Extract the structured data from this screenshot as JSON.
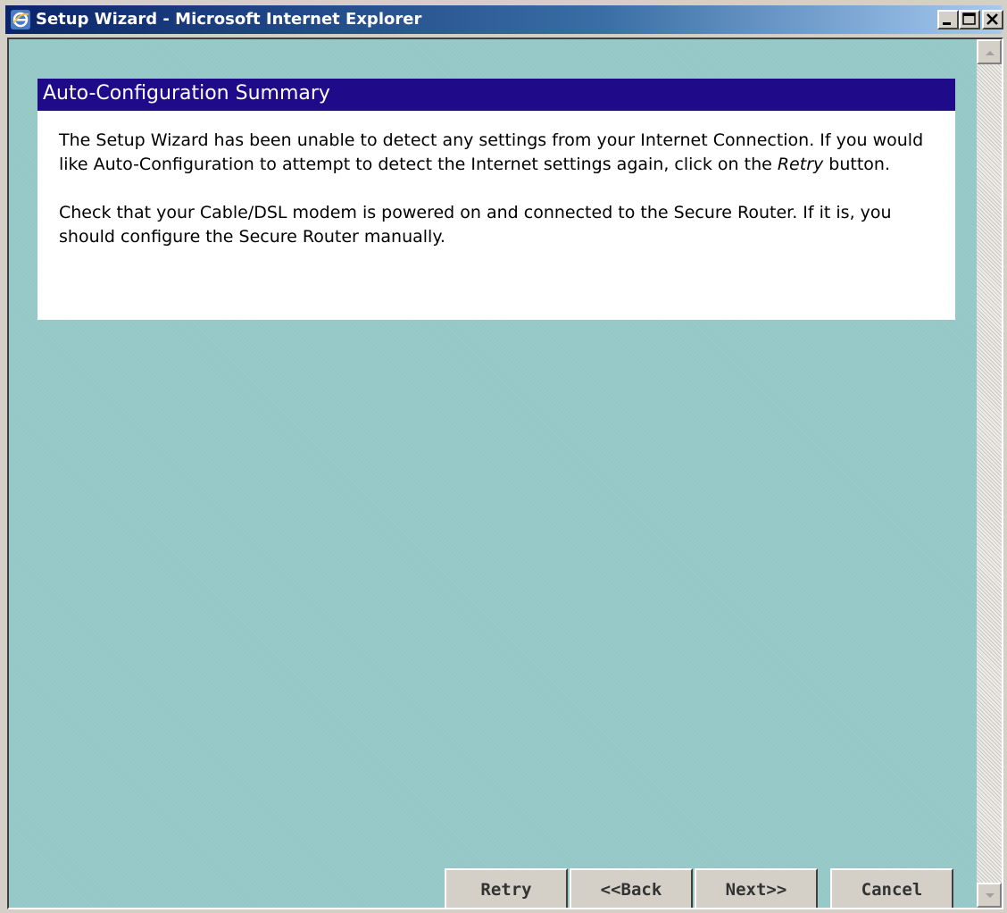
{
  "window": {
    "title": "Setup Wizard - Microsoft Internet Explorer",
    "icon": "internet-explorer-icon"
  },
  "panel": {
    "title": "Auto-Configuration Summary",
    "paragraph1_before": "The Setup Wizard has been unable to detect any settings from your Internet Connection. If you would like Auto-Configuration to attempt to detect the Internet settings again, click on the ",
    "paragraph1_emphasis": "Retry",
    "paragraph1_after": " button.",
    "paragraph2": "Check that your Cable/DSL modem is powered on and connected to the Secure Router. If it is, you should configure the Secure Router manually."
  },
  "buttons": {
    "retry": "Retry",
    "back": "<<Back",
    "next": "Next>>",
    "cancel": "Cancel"
  },
  "colors": {
    "panel_header": "#1f0a8a",
    "background": "#94c8c6"
  }
}
